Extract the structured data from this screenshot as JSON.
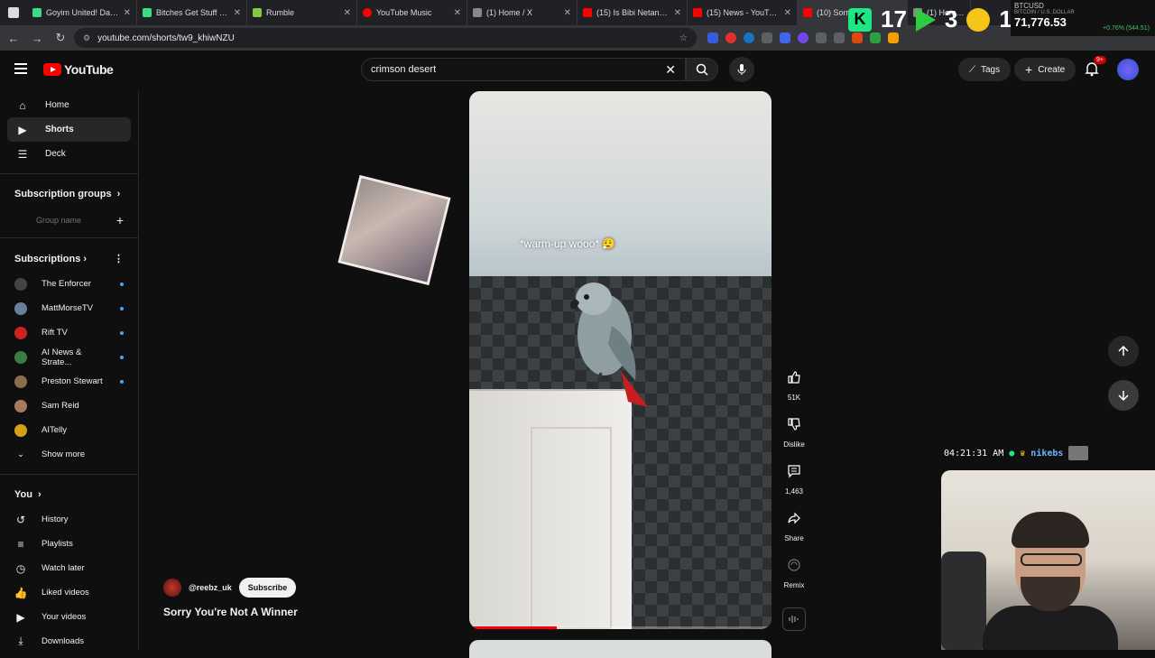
{
  "browser": {
    "tabs": [
      {
        "title": "Goyim United! Dan B",
        "color": "#3ddc84"
      },
      {
        "title": "Bitches Get Stuff Don",
        "color": "#3ddc84"
      },
      {
        "title": "Rumble",
        "color": "#85c742"
      },
      {
        "title": "YouTube Music",
        "color": "#ff0000"
      },
      {
        "title": "(1) Home / X",
        "color": "#888888"
      },
      {
        "title": "(15) Is Bibi Netanyah",
        "color": "#ff0000"
      },
      {
        "title": "(15) News - YouTube",
        "color": "#ff0000"
      },
      {
        "title": "(10) Sorry",
        "color": "#ff0000"
      },
      {
        "title": "(1) Home / X",
        "color": "#888888"
      }
    ],
    "url": "youtube.com/shorts/tw9_khiwNZU"
  },
  "overlay": {
    "counter_a": "17",
    "counter_b": "3",
    "counter_c": "1",
    "ticker_symbol": "BTCUSD",
    "ticker_name": "BITCOIN / U.S. DOLLAR",
    "ticker_price": "71,776.53",
    "ticker_change": "+0.76% (544.51)",
    "timestamp": "04:21:31 AM",
    "nickname": "nikebs"
  },
  "header": {
    "logo_text": "YouTube",
    "search_value": "crimson desert",
    "tags_label": "Tags",
    "create_label": "Create",
    "notif_count": "9+"
  },
  "sidebar": {
    "main": [
      {
        "label": "Home",
        "icon": "home-icon"
      },
      {
        "label": "Shorts",
        "icon": "shorts-icon"
      },
      {
        "label": "Deck",
        "icon": "deck-icon"
      }
    ],
    "subscription_groups_title": "Subscription groups",
    "group_name_placeholder": "Group name",
    "subscriptions_title": "Subscriptions",
    "subscriptions": [
      {
        "name": "The Enforcer",
        "color": "#444444"
      },
      {
        "name": "MattMorseTV",
        "color": "#6a7f99"
      },
      {
        "name": "Rift TV",
        "color": "#cc2222"
      },
      {
        "name": "AI News & Strate...",
        "color": "#3a7d44"
      },
      {
        "name": "Preston Stewart",
        "color": "#8a6d4a"
      },
      {
        "name": "Sam Reid",
        "color": "#a57a5d"
      },
      {
        "name": "AITelly",
        "color": "#d4a017"
      }
    ],
    "show_more": "Show more",
    "you_title": "You",
    "you_items": [
      {
        "label": "History"
      },
      {
        "label": "Playlists"
      },
      {
        "label": "Watch later"
      },
      {
        "label": "Liked videos"
      },
      {
        "label": "Your videos"
      },
      {
        "label": "Downloads"
      }
    ]
  },
  "short": {
    "caption": "*warm-up wooo* 😮‍💨",
    "channel": "@reebz_uk",
    "subscribe_label": "Subscribe",
    "title": "Sorry You're Not A Winner",
    "progress": 0.29,
    "actions": [
      {
        "label": "51K",
        "icon": "like-icon"
      },
      {
        "label": "Dislike",
        "icon": "dislike-icon"
      },
      {
        "label": "1,463",
        "icon": "comment-icon"
      },
      {
        "label": "Share",
        "icon": "share-icon"
      },
      {
        "label": "Remix",
        "icon": "remix-icon"
      }
    ]
  }
}
